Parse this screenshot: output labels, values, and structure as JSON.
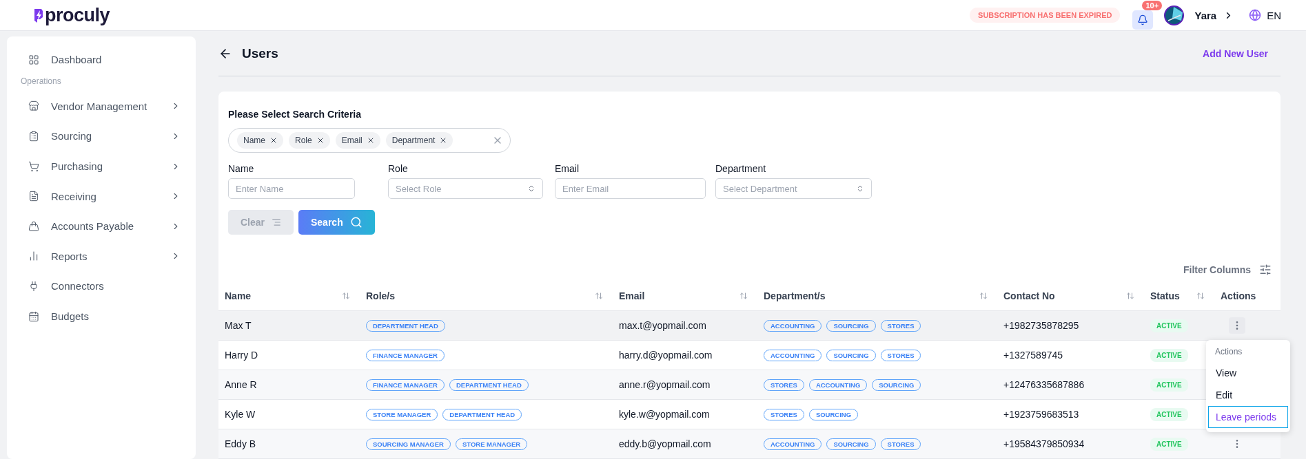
{
  "header": {
    "logo": "proculy",
    "subscription_notice": "SUBSCRIPTION HAS BEEN EXPIRED",
    "notifications_badge": "10+",
    "user_name": "Yara",
    "language": "EN"
  },
  "sidebar": {
    "items": [
      {
        "label": "Dashboard",
        "kind": "item",
        "has_submenu": false
      },
      {
        "label": "Operations",
        "kind": "section"
      },
      {
        "label": "Vendor Management",
        "kind": "item",
        "has_submenu": true
      },
      {
        "label": "Sourcing",
        "kind": "item",
        "has_submenu": true
      },
      {
        "label": "Purchasing",
        "kind": "item",
        "has_submenu": true
      },
      {
        "label": "Receiving",
        "kind": "item",
        "has_submenu": true
      },
      {
        "label": "Accounts Payable",
        "kind": "item",
        "has_submenu": true
      },
      {
        "label": "Reports",
        "kind": "item",
        "has_submenu": true
      },
      {
        "label": "Connectors",
        "kind": "item",
        "has_submenu": false
      },
      {
        "label": "Budgets",
        "kind": "item",
        "has_submenu": false
      }
    ]
  },
  "page": {
    "title": "Users",
    "primary_action": "Add New User"
  },
  "search": {
    "title": "Please Select Search Criteria",
    "criteria": [
      "Name",
      "Role",
      "Email",
      "Department"
    ],
    "fields": [
      {
        "label": "Name",
        "kind": "input",
        "placeholder": "Enter Name"
      },
      {
        "label": "Role",
        "kind": "select",
        "placeholder": "Select Role"
      },
      {
        "label": "Email",
        "kind": "input",
        "placeholder": "Enter Email"
      },
      {
        "label": "Department",
        "kind": "select",
        "placeholder": "Select Department"
      }
    ],
    "clear_button": {
      "label": "Clear",
      "disabled": true
    },
    "search_button": "Search"
  },
  "table": {
    "filter_columns": "Filter Columns",
    "columns": [
      {
        "label": "Name",
        "sortable": true
      },
      {
        "label": "Role/s",
        "sortable": true
      },
      {
        "label": "Email",
        "sortable": true
      },
      {
        "label": "Department/s",
        "sortable": true
      },
      {
        "label": "Contact No",
        "sortable": true
      },
      {
        "label": "Status",
        "sortable": true
      },
      {
        "label": "Actions",
        "sortable": false
      }
    ],
    "rows": [
      {
        "name": "Max T",
        "roles": [
          "DEPARTMENT HEAD"
        ],
        "email": "max.t@yopmail.com",
        "departments": [
          "ACCOUNTING",
          "SOURCING",
          "STORES"
        ],
        "contact": "+1982735878295",
        "status": "ACTIVE",
        "selected": true
      },
      {
        "name": "Harry D",
        "roles": [
          "FINANCE MANAGER"
        ],
        "email": "harry.d@yopmail.com",
        "departments": [
          "ACCOUNTING",
          "SOURCING",
          "STORES"
        ],
        "contact": "+1327589745",
        "status": "ACTIVE",
        "selected": false
      },
      {
        "name": "Anne R",
        "roles": [
          "FINANCE MANAGER",
          "DEPARTMENT HEAD"
        ],
        "email": "anne.r@yopmail.com",
        "departments": [
          "STORES",
          "ACCOUNTING",
          "SOURCING"
        ],
        "contact": "+12476335687886",
        "status": "ACTIVE",
        "selected": false
      },
      {
        "name": "Kyle W",
        "roles": [
          "STORE MANAGER",
          "DEPARTMENT HEAD"
        ],
        "email": "kyle.w@yopmail.com",
        "departments": [
          "STORES",
          "SOURCING"
        ],
        "contact": "+1923759683513",
        "status": "ACTIVE",
        "selected": false
      },
      {
        "name": "Eddy B",
        "roles": [
          "SOURCING MANAGER",
          "STORE MANAGER"
        ],
        "email": "eddy.b@yopmail.com",
        "departments": [
          "ACCOUNTING",
          "SOURCING",
          "STORES"
        ],
        "contact": "+19584379850934",
        "status": "ACTIVE",
        "selected": false
      }
    ]
  },
  "actions_menu": {
    "title": "Actions",
    "items": [
      {
        "label": "View",
        "selected": false
      },
      {
        "label": "Edit",
        "selected": false
      },
      {
        "label": "Leave periods",
        "selected": true
      }
    ]
  }
}
